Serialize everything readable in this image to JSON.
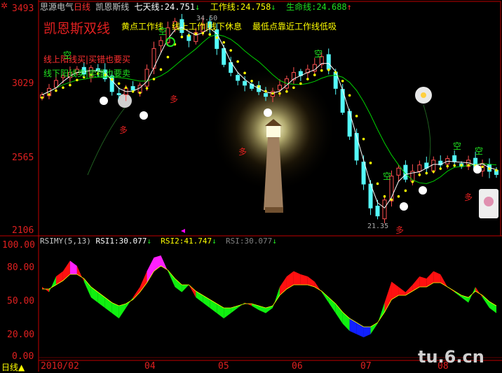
{
  "header": {
    "stock_name": "思源电气",
    "period": "日线",
    "indicator": "凯恩斯线",
    "ma7_label": "七天线:",
    "ma7_value": "24.751",
    "ma7_arrow": "↓",
    "work_label": "工作线:",
    "work_value": "24.758",
    "work_arrow": "↓",
    "life_label": "生命线:",
    "life_value": "24.688",
    "life_arrow": "↑"
  },
  "annotations": {
    "title": "凯恩斯双线",
    "tip1": "黄点工作线",
    "tip2": "线上工作|线下休息",
    "tip3": "最低点靠近工作线低吸",
    "rule_buy": "线上阳线买|买错也要买",
    "rule_sell": "线下阳线卖|卖错也要卖",
    "high_marker": "34.50",
    "low_marker": "21.35",
    "sell_mark": "空",
    "buy_mark": "多"
  },
  "price_axis": [
    "3493",
    "3029",
    "2565",
    "2106"
  ],
  "rsi_panel": {
    "name": "RSIMY(5,13)",
    "rsi1_label": "RSI1:",
    "rsi1_value": "30.077",
    "rsi1_arrow": "↓",
    "rsi2_label": "RSI2:",
    "rsi2_value": "41.747",
    "rsi2_arrow": "↓",
    "rsi_label": "RSI:",
    "rsi_value": "30.077",
    "rsi_arrow": "↓",
    "axis": [
      "100.00",
      "80.00",
      "50.00",
      "20.00",
      "0.00"
    ]
  },
  "footer": {
    "period_button": "日线",
    "dates": [
      "2010/02",
      "04",
      "05",
      "06",
      "07",
      "08"
    ]
  },
  "watermark": "tu.6.cn",
  "colors": {
    "up": "#ff5050",
    "down": "#54fcfc",
    "ma7": "#ffffff",
    "work": "#ffff00",
    "life": "#00d000",
    "axis": "#c00000"
  },
  "chart_data": {
    "type": "candlestick",
    "price_range": [
      2106,
      3493
    ],
    "closes": [
      2960,
      3000,
      3050,
      3080,
      3100,
      3120,
      3090,
      3130,
      3110,
      3060,
      2980,
      2960,
      3000,
      2990,
      3020,
      3120,
      3250,
      3300,
      3380,
      3420,
      3350,
      3300,
      3350,
      3400,
      3380,
      3250,
      3150,
      3100,
      3050,
      3020,
      3000,
      2980,
      2950,
      2980,
      3020,
      3060,
      3100,
      3080,
      3120,
      3150,
      3200,
      3120,
      3000,
      2850,
      2700,
      2550,
      2400,
      2250,
      2200,
      2300,
      2450,
      2500,
      2430,
      2480,
      2520,
      2500,
      2550,
      2520,
      2560,
      2540,
      2510,
      2550,
      2500,
      2530,
      2480,
      2460
    ],
    "rsi1": [
      60,
      55,
      70,
      75,
      85,
      80,
      65,
      50,
      45,
      40,
      35,
      30,
      40,
      50,
      60,
      75,
      88,
      90,
      75,
      60,
      55,
      62,
      50,
      45,
      40,
      35,
      30,
      35,
      40,
      45,
      42,
      38,
      35,
      40,
      60,
      70,
      75,
      72,
      70,
      65,
      55,
      45,
      35,
      25,
      18,
      15,
      12,
      15,
      25,
      45,
      65,
      60,
      55,
      62,
      70,
      68,
      75,
      72,
      60,
      55,
      50,
      45,
      60,
      50,
      40,
      35
    ],
    "rsi2": [
      58,
      58,
      62,
      66,
      72,
      72,
      68,
      60,
      55,
      50,
      45,
      42,
      44,
      48,
      55,
      64,
      75,
      80,
      76,
      68,
      62,
      62,
      56,
      52,
      48,
      44,
      40,
      40,
      42,
      44,
      44,
      42,
      40,
      42,
      52,
      58,
      62,
      62,
      62,
      60,
      56,
      50,
      44,
      36,
      30,
      26,
      22,
      22,
      26,
      36,
      48,
      52,
      52,
      56,
      60,
      60,
      64,
      64,
      60,
      56,
      52,
      50,
      56,
      52,
      46,
      42
    ]
  }
}
